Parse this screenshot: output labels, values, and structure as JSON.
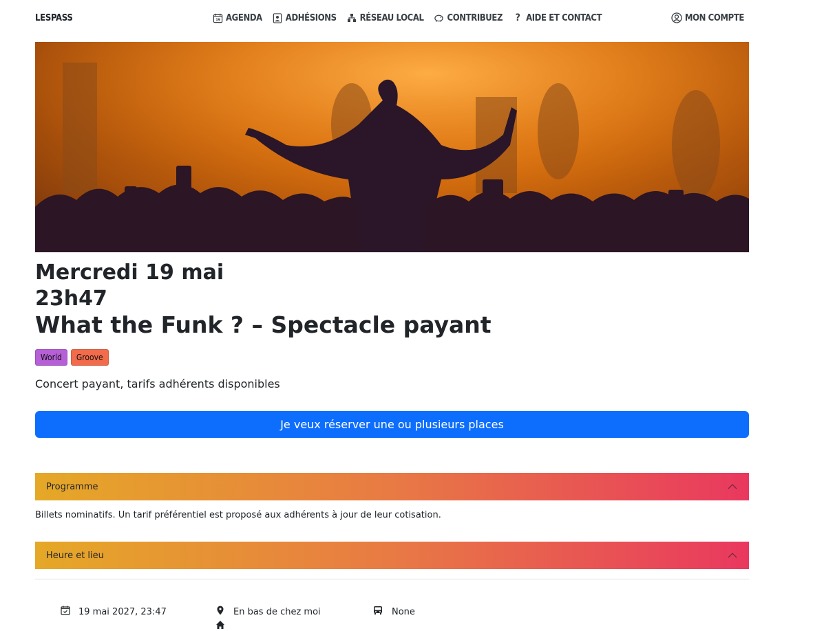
{
  "navbar": {
    "brand": "LESPASS",
    "links": [
      {
        "label": "AGENDA",
        "icon": "calendar-icon"
      },
      {
        "label": "ADHÉSIONS",
        "icon": "member-card-icon"
      },
      {
        "label": "RÉSEAU LOCAL",
        "icon": "network-icon"
      },
      {
        "label": "CONTRIBUEZ",
        "icon": "piggy-bank-icon"
      },
      {
        "label": "AIDE ET CONTACT",
        "icon": "question-icon"
      }
    ],
    "account": {
      "label": "MON COMPTE",
      "icon": "user-circle-icon"
    }
  },
  "hero": {
    "image": "concert-crowd-photo"
  },
  "event": {
    "date": "Mercredi 19 mai",
    "time": "23h47",
    "title": "What the Funk ? – Spectacle payant",
    "tags": [
      {
        "label": "World",
        "color": "#b65fd6"
      },
      {
        "label": "Groove",
        "color": "#f26b4a"
      }
    ],
    "subtitle": "Concert payant, tarifs adhérents disponibles"
  },
  "reserve_button": {
    "label": "Je veux réserver une ou plusieurs places",
    "color": "#0d6efd"
  },
  "accordion": {
    "programme": {
      "title": "Programme",
      "body": "Billets nominatifs. Un tarif préférentiel est proposé aux adhérents à jour de leur cotisation."
    },
    "heure_lieu": {
      "title": "Heure et lieu"
    }
  },
  "details": {
    "datetime": "19 mai 2027, 23:47",
    "location": "En bas de chez moi",
    "transport": "None"
  }
}
